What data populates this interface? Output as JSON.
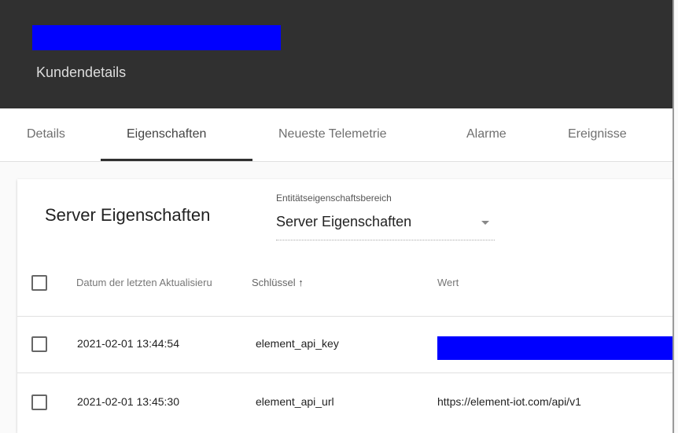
{
  "header": {
    "redacted_title_color": "#0000ff",
    "subtitle": "Kundendetails"
  },
  "tabs": [
    {
      "label": "Details"
    },
    {
      "label": "Eigenschaften",
      "active": true
    },
    {
      "label": "Neueste Telemetrie"
    },
    {
      "label": "Alarme"
    },
    {
      "label": "Ereignisse"
    }
  ],
  "card": {
    "title": "Server Eigenschaften",
    "scope_select": {
      "label": "Entitätseigenschaftsbereich",
      "value": "Server Eigenschaften"
    }
  },
  "table": {
    "columns": [
      "Datum der letzten Aktualisieru",
      "Schlüssel",
      "Wert"
    ],
    "sort_icon": "arrow-up-icon",
    "rows": [
      {
        "date": "2021-02-01 13:44:54",
        "key": "element_api_key",
        "value_redacted": true
      },
      {
        "date": "2021-02-01 13:45:30",
        "key": "element_api_url",
        "value": "https://element-iot.com/api/v1"
      }
    ]
  }
}
